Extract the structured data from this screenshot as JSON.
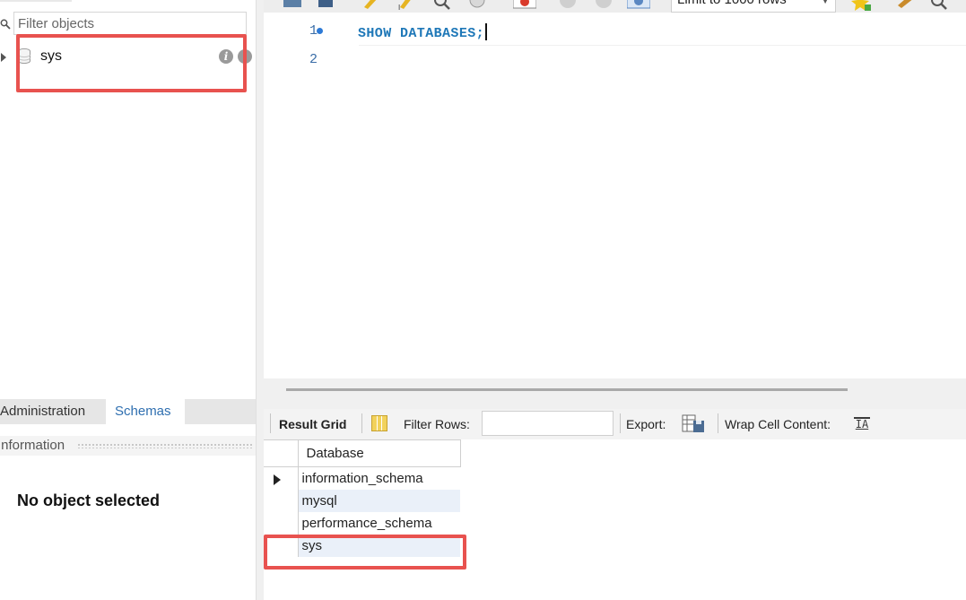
{
  "navigator": {
    "filter_placeholder": "Filter objects",
    "schemas": [
      {
        "label": "sys"
      }
    ],
    "tabs": [
      {
        "label": "Administration"
      },
      {
        "label": "Schemas"
      }
    ],
    "information_title": "Information",
    "no_object_message": "No object selected"
  },
  "toolbar": {
    "limit_select_value": "Limit to 1000 rows"
  },
  "editor": {
    "lines": [
      {
        "number": "1",
        "code": "SHOW DATABASES;"
      },
      {
        "number": "2",
        "code": ""
      }
    ]
  },
  "result_toolbar": {
    "result_grid_label": "Result Grid",
    "filter_rows_label": "Filter Rows:",
    "export_label": "Export:",
    "wrap_label": "Wrap Cell Content:",
    "wrap_icon_glyph": "IA"
  },
  "result_grid": {
    "columns": [
      "Database"
    ],
    "rows": [
      "information_schema",
      "mysql",
      "performance_schema",
      "sys"
    ]
  },
  "colors": {
    "highlight": "#e8524f",
    "keyword": "#1f78b8",
    "active_tab_text": "#2f6fb0",
    "alt_row": "#eaf0f9"
  }
}
